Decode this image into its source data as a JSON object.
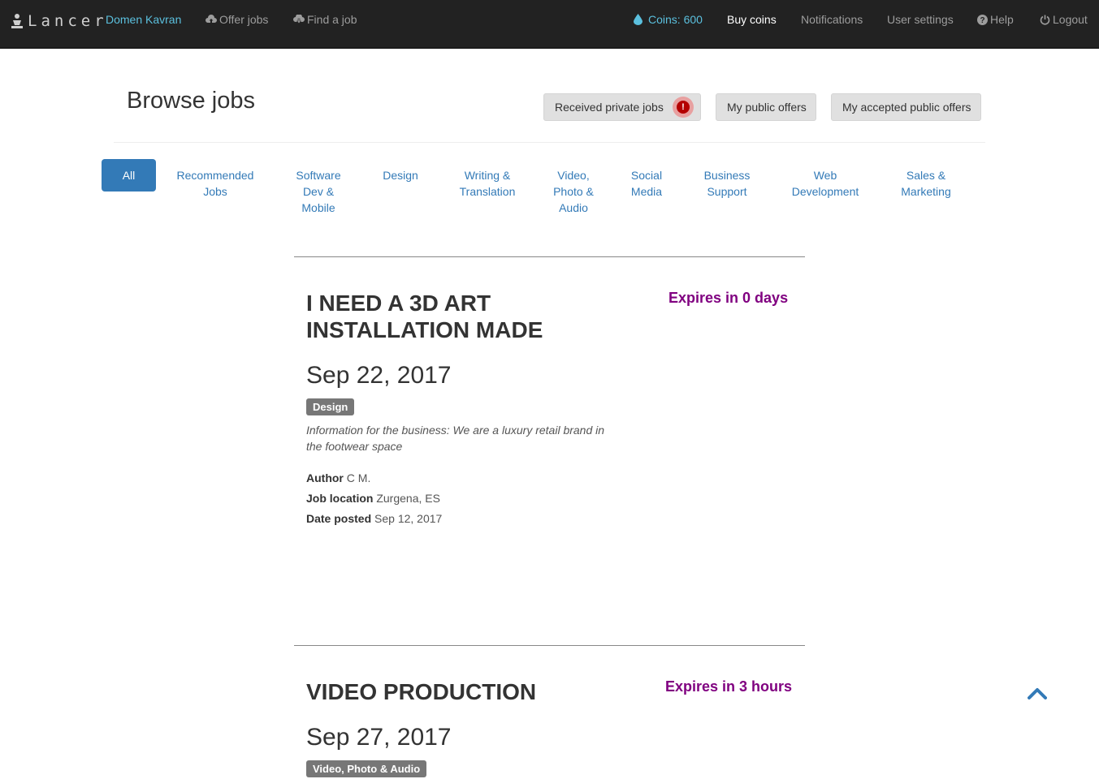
{
  "nav": {
    "brand": "Lancer",
    "user": "Domen Kavran",
    "offer_jobs": "Offer jobs",
    "find_job": "Find a job",
    "coins": "Coins: 600",
    "buy_coins": "Buy coins",
    "notifications": "Notifications",
    "user_settings": "User settings",
    "help": "Help",
    "logout": "Logout"
  },
  "header": {
    "title": "Browse jobs",
    "received_private": "Received private jobs",
    "alert_mark": "!",
    "my_public_offers": "My public offers",
    "my_accepted_offers": "My accepted public offers"
  },
  "categories": {
    "all": "All",
    "recommended": [
      "Recommended",
      "Jobs"
    ],
    "software": [
      "Software",
      "Dev &",
      "Mobile"
    ],
    "design": "Design",
    "writing": [
      "Writing &",
      "Translation"
    ],
    "video": [
      "Video,",
      "Photo &",
      "Audio"
    ],
    "social": [
      "Social",
      "Media"
    ],
    "business": [
      "Business",
      "Support"
    ],
    "web": [
      "Web",
      "Development"
    ],
    "sales": [
      "Sales &",
      "Marketing"
    ]
  },
  "jobs": [
    {
      "title": "I NEED A 3D ART INSTALLATION MADE",
      "expires": "Expires in 0 days",
      "date": "Sep 22, 2017",
      "tag": "Design",
      "description": "Information for the business: We are a luxury retail brand in the footwear space",
      "author_label": "Author",
      "author": "C M.",
      "location_label": "Job location",
      "location": "Zurgena, ES",
      "posted_label": "Date posted",
      "posted": "Sep 12, 2017"
    },
    {
      "title": "VIDEO PRODUCTION",
      "expires": "Expires in 3 hours",
      "date": "Sep 27, 2017",
      "tag": "Video, Photo & Audio"
    }
  ],
  "colors": {
    "navbar": "#222222",
    "link": "#337ab7",
    "accent_cyan": "#5bc0de",
    "expires": "#800080",
    "tag": "#777777"
  }
}
